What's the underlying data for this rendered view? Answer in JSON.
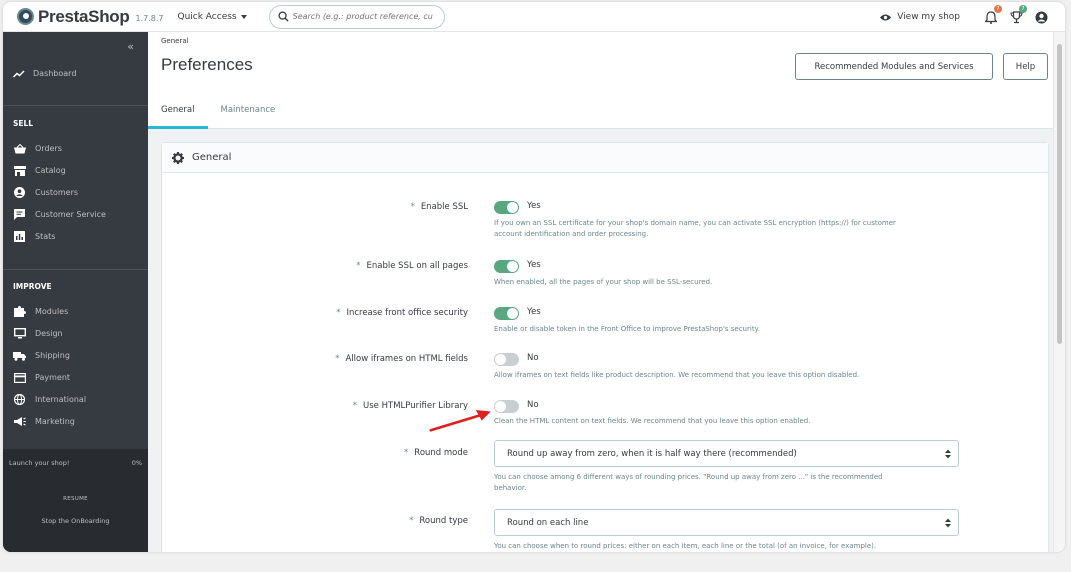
{
  "header": {
    "brand": "PrestaShop",
    "version": "1.7.8.7",
    "quick_access": "Quick Access",
    "search_placeholder": "Search (e.g.: product reference, custon",
    "view_shop": "View my shop",
    "notif_badge": "7",
    "trophy_badge": "7"
  },
  "sidebar": {
    "dashboard": "Dashboard",
    "sell_title": "SELL",
    "sell_items": [
      "Orders",
      "Catalog",
      "Customers",
      "Customer Service",
      "Stats"
    ],
    "improve_title": "IMPROVE",
    "improve_items": [
      "Modules",
      "Design",
      "Shipping",
      "Payment",
      "International",
      "Marketing"
    ],
    "launch": "Launch your shop!",
    "progress": "0%",
    "resume": "RESUME",
    "stop": "Stop the OnBoarding"
  },
  "page": {
    "breadcrumb": "General",
    "title": "Preferences",
    "btn_recommended": "Recommended Modules and Services",
    "btn_help": "Help",
    "tabs": [
      "General",
      "Maintenance"
    ]
  },
  "card": {
    "title": "General",
    "rows": [
      {
        "label": "Enable SSL",
        "value": "Yes",
        "on": true,
        "help": "If you own an SSL certificate for your shop's domain name, you can activate SSL encryption (https://) for customer account identification and order processing."
      },
      {
        "label": "Enable SSL on all pages",
        "value": "Yes",
        "on": true,
        "help": "When enabled, all the pages of your shop will be SSL-secured."
      },
      {
        "label": "Increase front office security",
        "value": "Yes",
        "on": true,
        "help": "Enable or disable token in the Front Office to improve PrestaShop's security."
      },
      {
        "label": "Allow iframes on HTML fields",
        "value": "No",
        "on": false,
        "help": "Allow iframes on text fields like product description. We recommend that you leave this option disabled."
      },
      {
        "label": "Use HTMLPurifier Library",
        "value": "No",
        "on": false,
        "help": "Clean the HTML content on text fields. We recommend that you leave this option enabled."
      }
    ],
    "round_mode_label": "Round mode",
    "round_mode_value": "Round up away from zero, when it is half way there (recommended)",
    "round_mode_help": "You can choose among 6 different ways of rounding prices. \"Round up away from zero ...\" is the recommended behavior.",
    "round_type_label": "Round type",
    "round_type_value": "Round on each line",
    "round_type_help": "You can choose when to round prices: either on each item, each line or the total (of an invoice, for example)."
  },
  "colors": {
    "sidebar": "#363a41",
    "toggle_on": "#58a780",
    "accent": "#25b9d7",
    "annotation_arrow": "#e02020"
  }
}
